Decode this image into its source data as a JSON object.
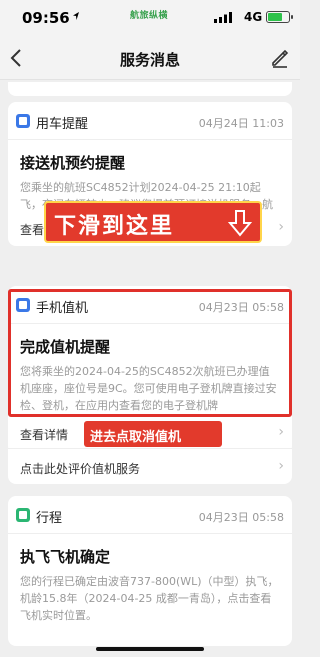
{
  "status_bar": {
    "time": "09:56",
    "app_label": "航旅纵横",
    "network": "4G",
    "battery_level": 0.75
  },
  "nav": {
    "title": "服务消息"
  },
  "cards": [
    {
      "category": "用车提醒",
      "date": "04月24日 11:03",
      "title": "接送机预约提醒",
      "body": "您乘坐的航班SC4852计划2024-04-25 21:10起飞，夜间车辆较少，建议您提前预订接送机服务，航班信息联动，享安心出行！",
      "detail_label": "查看详情"
    },
    {
      "category": "手机值机",
      "date": "04月23日 05:58",
      "title": "完成值机提醒",
      "body": "您将乘坐的2024-04-25的SC4852次航班已办理值机座座，座位号是9C。您可使用电子登机牌直接过安检、登机，在应用内查看您的电子登机牌",
      "detail_label": "查看详情",
      "extra_link": "点击此处评价值机服务"
    },
    {
      "category": "行程",
      "date": "04月23日 05:58",
      "title": "执飞飞机确定",
      "body": "您的行程已确定由波音737-800(WL)（中型）执飞，机龄15.8年（2024-04-25 成都一青岛），点击查看飞机实时位置。"
    }
  ],
  "overlays": {
    "banner": "下滑到这里",
    "tip": "进去点取消值机"
  },
  "colors": {
    "accent_red": "#e23a2c",
    "icon_blue": "#3b78e7",
    "icon_green": "#2bb673"
  }
}
